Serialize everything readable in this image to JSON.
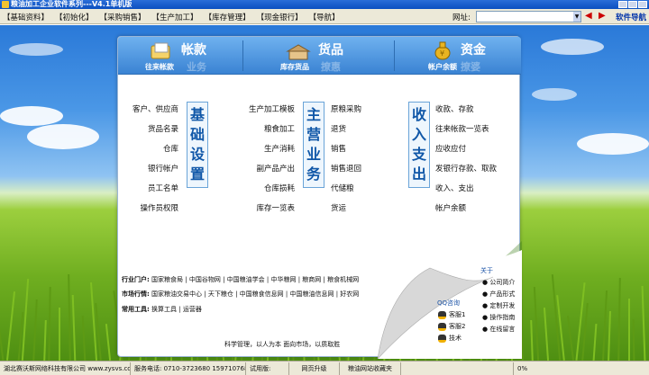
{
  "window": {
    "title": "粮油加工企业软件系列---V4.1单机版"
  },
  "menu": [
    "【基础资料】",
    "【初始化】",
    "【采购销售】",
    "【生产加工】",
    "【库存管理】",
    "【现金银行】",
    "【导航】"
  ],
  "address": {
    "label": "网址:",
    "value": ""
  },
  "nav_link": "软件导航",
  "headers": [
    {
      "title": "帐款",
      "sub": "往来帐款",
      "ghost": "业务"
    },
    {
      "title": "货品",
      "sub": "库存货品",
      "ghost": "撩惠"
    },
    {
      "title": "资金",
      "sub": "帐户余额",
      "ghost": "撩婆"
    }
  ],
  "sections": {
    "basic": {
      "title": [
        "基",
        "础",
        "设",
        "置"
      ],
      "items": [
        "客户、供应商",
        "货品名录",
        "仓库",
        "银行帐户",
        "员工名单",
        "操作员权限"
      ]
    },
    "main": {
      "title": [
        "主",
        "营",
        "业",
        "务"
      ],
      "left": [
        "生产加工模板",
        "粮食加工",
        "生产消耗",
        "副产品产出",
        "仓库损耗",
        "库存一览表"
      ],
      "right": [
        "原粮采购",
        "退货",
        "销售",
        "销售退回",
        "代储粮",
        "货运"
      ]
    },
    "cash": {
      "title": [
        "收",
        "入",
        "支",
        "出"
      ],
      "items": [
        "收款、存款",
        "往来帐款一览表",
        "应收应付",
        "发银行存款、取款",
        "收入、支出",
        "帐户余额"
      ]
    }
  },
  "footer": {
    "industry_label": "行业门户:",
    "industry": [
      "国家粮食局",
      "中国谷物网",
      "中国粮油学会",
      "中华粮网",
      "粮商网",
      "粮食机械网"
    ],
    "market_label": "市场行情:",
    "market": [
      "国家粮油交易中心",
      "天下粮仓",
      "中国粮食信息网",
      "中国粮油信息网",
      "好农网"
    ],
    "tools_label": "常用工具:",
    "tools": [
      "换算工具",
      "运营器"
    ],
    "slogan": "科学管理，以人为本  面向市场，以质取胜"
  },
  "qq": {
    "label": "QQ咨询",
    "items": [
      "客服1",
      "客服2",
      "技术"
    ]
  },
  "about": {
    "label": "关于",
    "items": [
      "公司简介",
      "产品形式",
      "定制开发",
      "操作指南",
      "在线留言"
    ]
  },
  "status": [
    "湖北赛沃斯网络科技有限公司  www.zysvs.com",
    "服务电话: 0710-3723680  15971076809",
    "试用版:",
    "网页升级",
    "粮油网站收藏夹",
    "",
    "0%"
  ]
}
